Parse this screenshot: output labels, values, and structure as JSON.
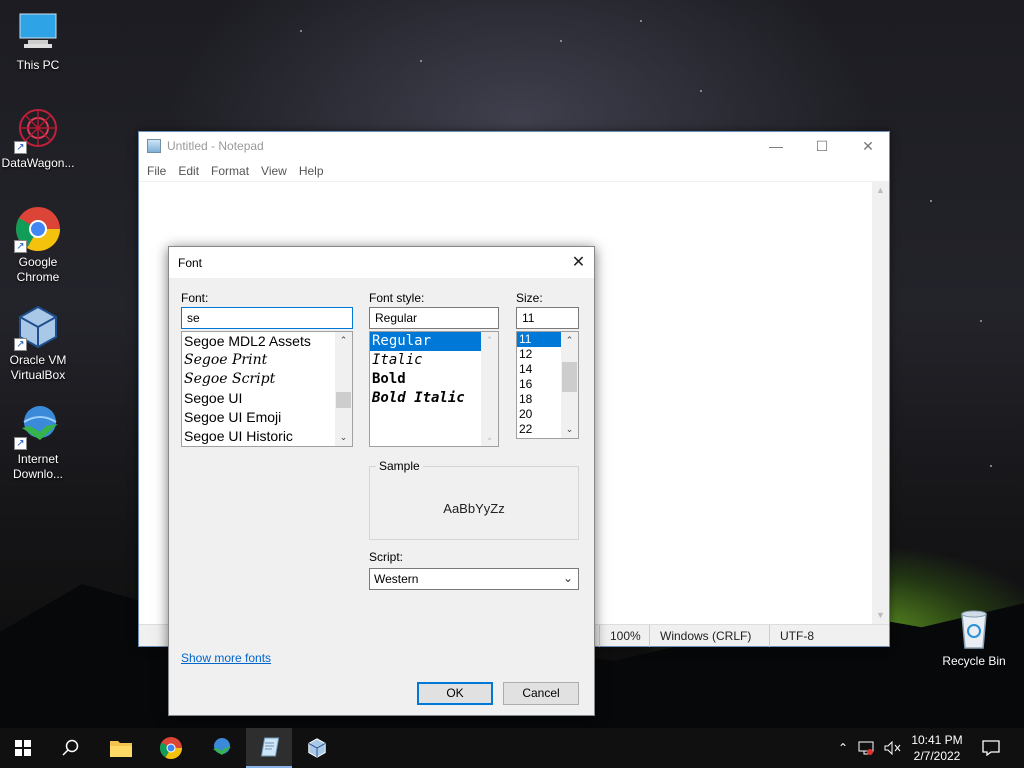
{
  "desktop": {
    "icons": [
      {
        "label": "This PC",
        "icon": "this-pc-icon"
      },
      {
        "label": "DataWagon...",
        "icon": "datawagon-icon"
      },
      {
        "label": "Google Chrome",
        "icon": "chrome-icon"
      },
      {
        "label": "Oracle VM VirtualBox",
        "icon": "virtualbox-icon"
      },
      {
        "label": "Internet Downlo...",
        "icon": "internet-download-manager-icon"
      },
      {
        "label": "Recycle Bin",
        "icon": "recycle-bin-icon"
      }
    ]
  },
  "notepad": {
    "title": "Untitled - Notepad",
    "menu": [
      "File",
      "Edit",
      "Format",
      "View",
      "Help"
    ],
    "status": {
      "zoom": "100%",
      "line_ending": "Windows (CRLF)",
      "encoding": "UTF-8"
    }
  },
  "font_dialog": {
    "title": "Font",
    "font_label": "Font:",
    "font_value": "se",
    "font_items": [
      "Segoe MDL2 Assets",
      "Segoe Print",
      "Segoe Script",
      "Segoe UI",
      "Segoe UI Emoji",
      "Segoe UI Historic"
    ],
    "style_label": "Font style:",
    "style_value": "Regular",
    "style_items": [
      "Regular",
      "Italic",
      "Bold",
      "Bold Italic"
    ],
    "size_label": "Size:",
    "size_value": "11",
    "size_items": [
      "11",
      "12",
      "14",
      "16",
      "18",
      "20",
      "22"
    ],
    "sample_label": "Sample",
    "sample_text": "AaBbYyZz",
    "script_label": "Script:",
    "script_value": "Western",
    "show_more_link": "Show more fonts",
    "ok_label": "OK",
    "cancel_label": "Cancel"
  },
  "taskbar": {
    "time": "10:41 PM",
    "date": "2/7/2022",
    "pinned": [
      "start-icon",
      "search-icon",
      "file-explorer-icon",
      "chrome-icon",
      "internet-download-manager-icon",
      "notepad-icon",
      "virtualbox-icon"
    ]
  }
}
